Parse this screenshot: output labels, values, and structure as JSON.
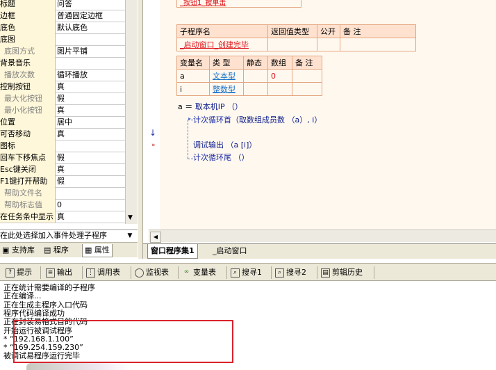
{
  "properties": [
    {
      "name": "标题",
      "value": "问答",
      "sub": false
    },
    {
      "name": "边框",
      "value": "普通固定边框",
      "sub": false
    },
    {
      "name": "底色",
      "value": "默认底色",
      "sub": false
    },
    {
      "name": "底图",
      "value": "",
      "sub": false
    },
    {
      "name": "底图方式",
      "value": "图片平铺",
      "sub": true
    },
    {
      "name": "背景音乐",
      "value": "",
      "sub": false
    },
    {
      "name": "播放次数",
      "value": "循环播放",
      "sub": true
    },
    {
      "name": "控制按钮",
      "value": "真",
      "sub": false
    },
    {
      "name": "最大化按钮",
      "value": "假",
      "sub": true
    },
    {
      "name": "最小化按钮",
      "value": "真",
      "sub": true
    },
    {
      "name": "位置",
      "value": "居中",
      "sub": false
    },
    {
      "name": "可否移动",
      "value": "真",
      "sub": false
    },
    {
      "name": "图标",
      "value": "",
      "sub": false
    },
    {
      "name": "回车下移焦点",
      "value": "假",
      "sub": false
    },
    {
      "name": "Esc键关闭",
      "value": "真",
      "sub": false
    },
    {
      "name": "F1键打开帮助",
      "value": "假",
      "sub": false
    },
    {
      "name": "帮助文件名",
      "value": "",
      "sub": true
    },
    {
      "name": "帮助标志值",
      "value": "0",
      "sub": true
    },
    {
      "name": "在任务条中显示",
      "value": "真",
      "sub": false
    }
  ],
  "prop_footer": "在此处选择加入事件处理子程序",
  "left_tabs": [
    "支持库",
    "程序",
    "属性"
  ],
  "sub_header": {
    "name_col": "子程序名",
    "return_col": "返回值类型",
    "public_col": "公开",
    "note_col": "备 注"
  },
  "sub_name": "_启动窗口_创建完毕",
  "top_partial": "_按钮1_被单击",
  "var_header": [
    "变量名",
    "类 型",
    "静态",
    "数组",
    "备 注"
  ],
  "variables": [
    {
      "name": "a",
      "type": "文本型",
      "array": "0"
    },
    {
      "name": "i",
      "type": "整数型",
      "array": ""
    }
  ],
  "code": {
    "line1_var": "a ＝ ",
    "line1_call": "取本机IP （）",
    "line2_kw": "计次循环首",
    "line2_args": "（取数组成员数 （a）, i）",
    "line3_call": "调试输出",
    "line3_args": " （a [i]）",
    "line4_kw": "计次循环尾",
    "line4_args": " （）"
  },
  "code_tabs": [
    "窗口程序集1",
    "_启动窗口"
  ],
  "output_toolbar": [
    "提示",
    "输出",
    "调用表",
    "监视表",
    "变量表",
    "搜寻1",
    "搜寻2",
    "剪辑历史"
  ],
  "output_lines": [
    "正在统计需要编译的子程序",
    "正在编译...",
    "正在生成主程序入口代码",
    "程序代码编译成功",
    "正在封装易格式目的代码",
    "开始运行被调试程序",
    "* “192.168.1.100”",
    "* “169.254.159.230”",
    "被调试易程序运行完毕"
  ],
  "colors": {
    "grid_border": "#e5a57f",
    "grid_header": "#ffe1cf",
    "highlight": "#d9232c"
  }
}
